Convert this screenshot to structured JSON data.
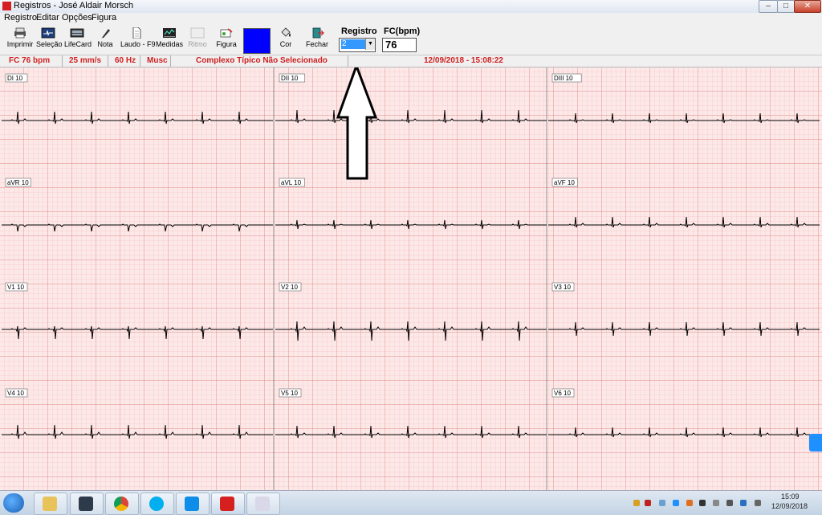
{
  "window": {
    "title": "Registros - José Aldair Morsch"
  },
  "menu": [
    "Registro",
    "Editar",
    "Opções",
    "Figura"
  ],
  "toolbar": {
    "imprimir": "Imprimir",
    "selecao": "Seleção",
    "lifecard": "LifeCard",
    "nota": "Nota",
    "laudo": "Laudo - F9",
    "medidas": "Medidas",
    "ritmo": "Ritmo",
    "figura": "Figura",
    "cor": "Cor",
    "fechar": "Fechar",
    "registro_label": "Registro",
    "registro_value": "2",
    "fc_label": "FC(bpm)",
    "fc_value": "76",
    "swatch_color": "#0000ff"
  },
  "status": {
    "fc": "FC 76 bpm",
    "speed": "25 mm/s",
    "freq": "60 Hz",
    "filter": "Musc",
    "complexo": "Complexo Típico Não Selecionado",
    "datetime": "12/09/2018 - 15:08:22"
  },
  "leads": [
    [
      "DI 10",
      "DII 10",
      "DIII 10"
    ],
    [
      "aVR 10",
      "aVL 10",
      "aVF 10"
    ],
    [
      "V1 10",
      "V2 10",
      "V3 10"
    ],
    [
      "V4 10",
      "V5 10",
      "V6 10"
    ]
  ],
  "colors": {
    "grid_minor": "#f4b0b0",
    "grid_major": "#e08080",
    "paper": "#fde6e6",
    "trace": "#000000",
    "status_text": "#d02020"
  },
  "taskbar": {
    "time": "15:09",
    "date": "12/09/2018",
    "apps": [
      "file-explorer-icon",
      "scanner-icon",
      "chrome-icon",
      "skype-icon",
      "teamviewer-icon",
      "ecg-app-icon",
      "paint-icon"
    ]
  }
}
